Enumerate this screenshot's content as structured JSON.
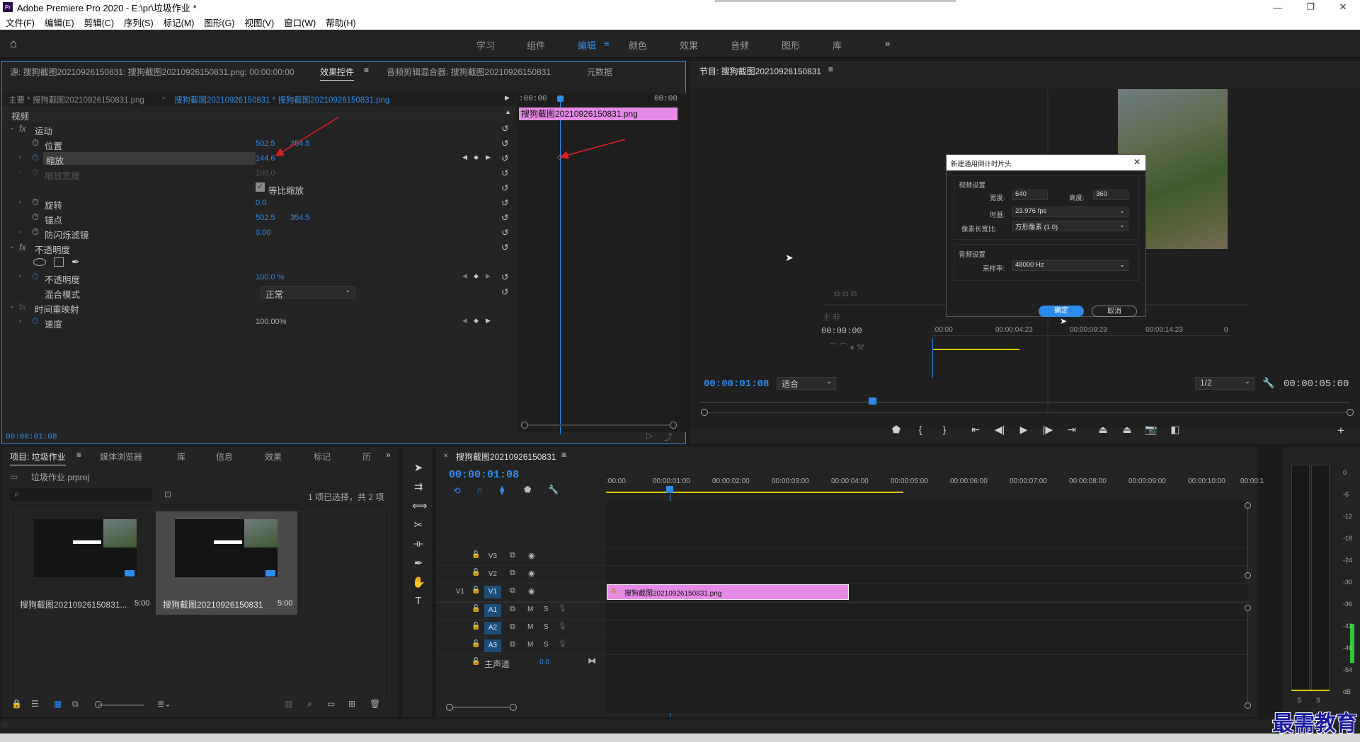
{
  "app": {
    "title": "Adobe Premiere Pro 2020 - E:\\pr\\垃圾作业 *",
    "logo_text": "Pr",
    "window_controls": {
      "minimize": "—",
      "restore": "❐",
      "close": "✕"
    }
  },
  "menu": [
    "文件(F)",
    "编辑(E)",
    "剪辑(C)",
    "序列(S)",
    "标记(M)",
    "图形(G)",
    "视图(V)",
    "窗口(W)",
    "帮助(H)"
  ],
  "workspaces": [
    "学习",
    "组件",
    "编辑",
    "颜色",
    "效果",
    "音频",
    "图形",
    "库"
  ],
  "workspace_active": "编辑",
  "workspace_more": "»",
  "source_panel": {
    "tabs": [
      "源: 搜狗截图20210926150831: 搜狗截图20210926150831.png: 00:00:00:00",
      "效果控件",
      "音频剪辑混合器: 搜狗截图20210926150831",
      "元数据"
    ],
    "active_tab": "效果控件",
    "master_label": "主要 * 搜狗截图20210926150831.png",
    "clip_label": "搜狗截图20210926150831 * 搜狗截图20210926150831.png",
    "mini_tc_start": ":00:00",
    "mini_tc_end": "00:00",
    "mini_clip": "搜狗截图20210926150831.png",
    "section_video": "视频",
    "motion": "运动",
    "position_label": "位置",
    "position_x": "502.5",
    "position_y": "354.5",
    "scale_label": "缩放",
    "scale_value": "144.6",
    "scale_width_label": "缩放宽度",
    "scale_width_value": "100.0",
    "uniform_scale": "等比缩放",
    "rotation_label": "旋转",
    "rotation_value": "0.0",
    "anchor_label": "锚点",
    "anchor_x": "502.5",
    "anchor_y": "354.5",
    "flicker_label": "防闪烁滤镜",
    "flicker_value": "0.00",
    "opacity_section": "不透明度",
    "opacity_label": "不透明度",
    "opacity_value": "100.0 %",
    "blend_label": "混合模式",
    "blend_value": "正常",
    "time_remap": "时间重映射",
    "speed_label": "速度",
    "speed_value": "100.00%",
    "footer_tc": "00:00:01:08"
  },
  "program_panel": {
    "title": "节目: 搜狗截图20210926150831",
    "timecode": "00:00:01:08",
    "fit": "适合",
    "quality": "1/2",
    "duration": "00:00:05:00",
    "inner_tc": "00:00:00",
    "inner_ruler": [
      ":00:00",
      "00:00:04:23",
      "00:00:09:23",
      "00:00:14:23",
      "0"
    ]
  },
  "dialog": {
    "title": "新建通用倒计时片头",
    "video_settings": "视频设置",
    "width_label": "宽度:",
    "width_value": "640",
    "height_label": "高度:",
    "height_value": "360",
    "timebase_label": "时基:",
    "timebase_value": "23.976 fps",
    "par_label": "像素长宽比:",
    "par_value": "方形像素 (1.0)",
    "audio_settings": "音频设置",
    "samplerate_label": "采样率:",
    "samplerate_value": "48000 Hz",
    "ok": "确定",
    "cancel": "取消"
  },
  "project_panel": {
    "tabs": [
      "项目: 垃圾作业",
      "媒体浏览器",
      "库",
      "信息",
      "效果",
      "标记",
      "历"
    ],
    "project_file": "垃圾作业.prproj",
    "selection_info": "1 项已选择，共 2 项",
    "items": [
      {
        "name": "搜狗截图20210926150831...",
        "duration": "5:00"
      },
      {
        "name": "搜狗截图20210926150831",
        "duration": "5:00"
      }
    ]
  },
  "timeline": {
    "sequence": "搜狗截图20210926150831",
    "timecode": "00:00:01:08",
    "ruler": [
      ":00:00",
      "00:00:01:00",
      "00:00:02:00",
      "00:00:03:00",
      "00:00:04:00",
      "00:00:05:00",
      "00:00:06:00",
      "00:00:07:00",
      "00:00:08:00",
      "00:00:09:00",
      "00:00:10:00",
      "00:00:1"
    ],
    "video_tracks": [
      "V3",
      "V2",
      "V1"
    ],
    "audio_tracks": [
      "A1",
      "A2",
      "A3"
    ],
    "source_v1": "V1",
    "mute": "M",
    "solo": "S",
    "master_label": "主声道",
    "master_value": "0.0",
    "clip_name": "搜狗截图20210926150831.png",
    "clip_fx": "fx"
  },
  "meter": {
    "scale": [
      "0",
      "-6",
      "-12",
      "-18",
      "-24",
      "-30",
      "-36",
      "-42",
      "-48",
      "-54",
      "dB"
    ],
    "solo_labels": [
      "S",
      "S"
    ]
  },
  "watermark": "最需教育",
  "colors": {
    "accent": "#2d8ceb",
    "clip": "#e68ae6",
    "yellow": "#d8c800",
    "dialog_ok": "#2d8ceb"
  }
}
